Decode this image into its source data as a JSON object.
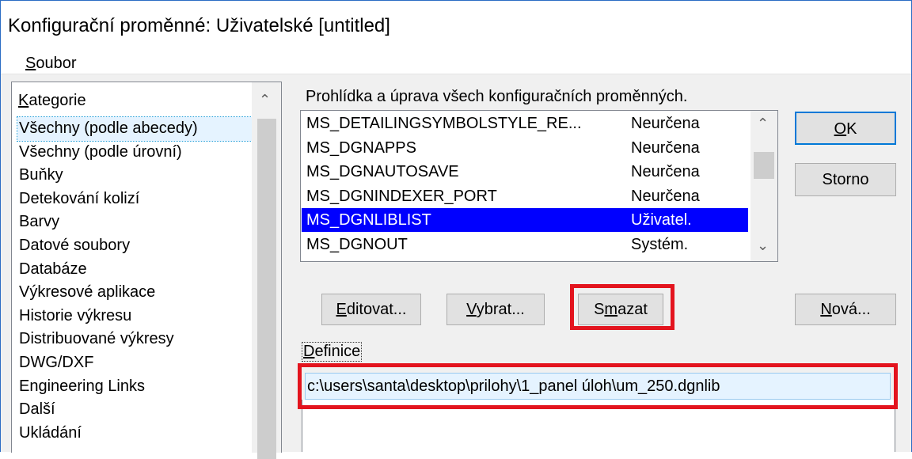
{
  "window": {
    "title": "Konfigurační proměnné: Uživatelské [untitled]"
  },
  "menu": {
    "file_first": "S",
    "file_rest": "oubor"
  },
  "categories": {
    "header_first": "K",
    "header_rest": "ategorie",
    "items": [
      "Všechny (podle abecedy)",
      "Všechny (podle úrovní)",
      "Buňky",
      "Detekování kolizí",
      "Barvy",
      "Datové soubory",
      "Databáze",
      "Výkresové aplikace",
      "Historie výkresu",
      "Distribuované výkresy",
      "DWG/DXF",
      "Engineering Links",
      "Další",
      "Ukládání"
    ],
    "selected_index": 0
  },
  "variables": {
    "description": "Prohlídka a úprava všech konfiguračních proměnných.",
    "rows": [
      {
        "name": "MS_DETAILINGSYMBOLSTYLE_RE...",
        "type": "Neurčena"
      },
      {
        "name": "MS_DGNAPPS",
        "type": "Neurčena"
      },
      {
        "name": "MS_DGNAUTOSAVE",
        "type": "Neurčena"
      },
      {
        "name": "MS_DGNINDEXER_PORT",
        "type": "Neurčena"
      },
      {
        "name": "MS_DGNLIBLIST",
        "type": "Uživatel."
      },
      {
        "name": "MS_DGNOUT",
        "type": "Systém."
      }
    ],
    "selected_index": 4
  },
  "buttons": {
    "ok_first": "O",
    "ok_rest": "K",
    "storno": "Storno",
    "edit_first": "E",
    "edit_rest": "ditovat...",
    "select_first": "V",
    "select_rest": "ybrat...",
    "delete_pre": "S",
    "delete_ul": "m",
    "delete_rest": "azat",
    "new_first": "N",
    "new_rest": "ová..."
  },
  "definition": {
    "label_first": "D",
    "label_rest": "efinice",
    "value": "c:\\users\\santa\\desktop\\prilohy\\1_panel úloh\\um_250.dgnlib"
  },
  "colors": {
    "highlight": "#e3141e",
    "selection": "#0000ff"
  }
}
